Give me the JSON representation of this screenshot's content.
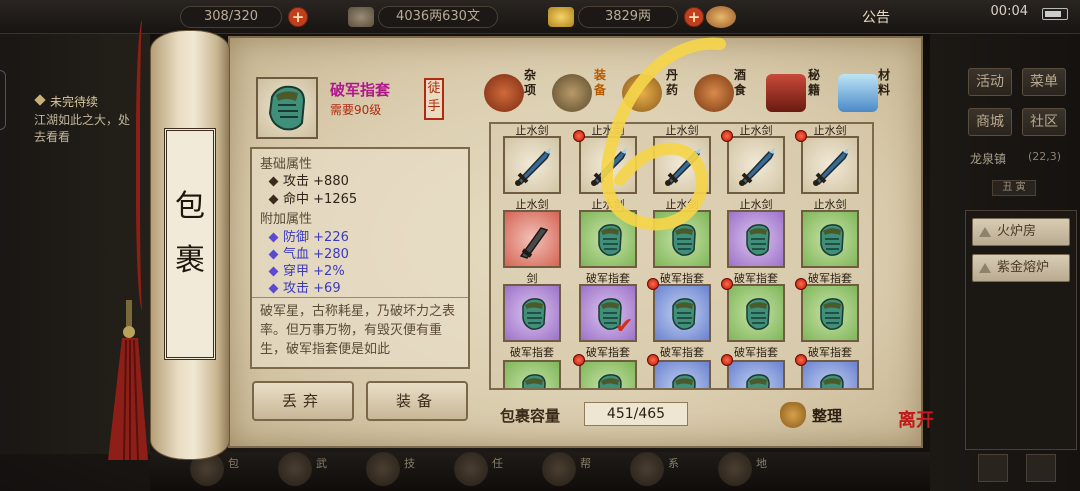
{
  "topbar": {
    "capacity_text": "308/320",
    "copper_text": "4036两630文",
    "silver_text": "3829两",
    "notice": "公告",
    "clock": "00:04"
  },
  "quest": {
    "title": "未完待续",
    "desc": "江湖如此之大，处去看看"
  },
  "right_panel": {
    "buttons": [
      "活动",
      "菜单",
      "商城",
      "社区"
    ],
    "location": "龙泉镇",
    "coords": "(22,3)",
    "time": "丑 寅",
    "facilities": [
      "火炉房",
      "紫金熔炉"
    ]
  },
  "scroll_title": "包裹",
  "item": {
    "name": "破军指套",
    "requirement": "需要90级",
    "tier": "徒手",
    "base_header": "基础属性",
    "base_stats": [
      {
        "label": "攻击",
        "value": "+880"
      },
      {
        "label": "命中",
        "value": "+1265"
      }
    ],
    "extra_header": "附加属性",
    "extra_stats": [
      {
        "label": "防御",
        "value": "+226"
      },
      {
        "label": "气血",
        "value": "+280"
      },
      {
        "label": "穿甲",
        "value": "+2%"
      },
      {
        "label": "攻击",
        "value": "+69"
      }
    ],
    "description": "破军星，古称耗星，乃破坏力之表率。但万事万物，有毁灭便有重生，破军指套便是如此"
  },
  "actions": {
    "discard": "丢弃",
    "equip": "装备"
  },
  "tabs": [
    "杂项",
    "装备",
    "丹药",
    "酒食",
    "秘籍",
    "材料"
  ],
  "grid": {
    "top_labels": [
      "止水剑",
      "止水剑",
      "止水剑",
      "止水剑",
      "止水剑"
    ],
    "rows": [
      [
        {
          "label": "止水剑",
          "kind": "sword",
          "color": "plain",
          "dot": false
        },
        {
          "label": "止水剑",
          "kind": "sword",
          "color": "plain",
          "dot": true
        },
        {
          "label": "止水剑",
          "kind": "sword",
          "color": "plain",
          "dot": false
        },
        {
          "label": "止水剑",
          "kind": "sword",
          "color": "plain",
          "dot": true
        },
        {
          "label": "止水剑",
          "kind": "sword",
          "color": "plain",
          "dot": true
        }
      ],
      [
        {
          "label": "剑",
          "kind": "blade",
          "color": "red",
          "dot": false
        },
        {
          "label": "破军指套",
          "kind": "gauntlet",
          "color": "green",
          "dot": false
        },
        {
          "label": "破军指套",
          "kind": "gauntlet",
          "color": "green",
          "dot": false
        },
        {
          "label": "破军指套",
          "kind": "gauntlet",
          "color": "purple",
          "dot": false
        },
        {
          "label": "破军指套",
          "kind": "gauntlet",
          "color": "green",
          "dot": false
        }
      ],
      [
        {
          "label": "破军指套",
          "kind": "gauntlet",
          "color": "purple",
          "dot": false
        },
        {
          "label": "破军指套",
          "kind": "gauntlet",
          "color": "purple",
          "dot": false,
          "checked": true
        },
        {
          "label": "破军指套",
          "kind": "gauntlet",
          "color": "blue",
          "dot": true
        },
        {
          "label": "破军指套",
          "kind": "gauntlet",
          "color": "green",
          "dot": true
        },
        {
          "label": "破军指套",
          "kind": "gauntlet",
          "color": "green",
          "dot": true
        }
      ],
      [
        {
          "label": "",
          "kind": "gauntlet",
          "color": "green",
          "dot": false
        },
        {
          "label": "",
          "kind": "gauntlet",
          "color": "green",
          "dot": true
        },
        {
          "label": "",
          "kind": "gauntlet",
          "color": "blue",
          "dot": true
        },
        {
          "label": "",
          "kind": "gauntlet",
          "color": "blue",
          "dot": true
        },
        {
          "label": "",
          "kind": "gauntlet",
          "color": "blue",
          "dot": true
        }
      ]
    ]
  },
  "capacity": {
    "label": "包裹容量",
    "value": "451/465"
  },
  "sort_label": "整理",
  "leave_label": "离开",
  "bottom_labels": [
    "包",
    "武",
    "技",
    "任",
    "帮",
    "系",
    "地"
  ],
  "colors": {
    "parchment": "#e7dcc3",
    "item_name": "#b0188a",
    "requirement": "#b02a12",
    "extra_stat": "#3a3ac0",
    "overlay_scribble": "#f5d54a"
  }
}
